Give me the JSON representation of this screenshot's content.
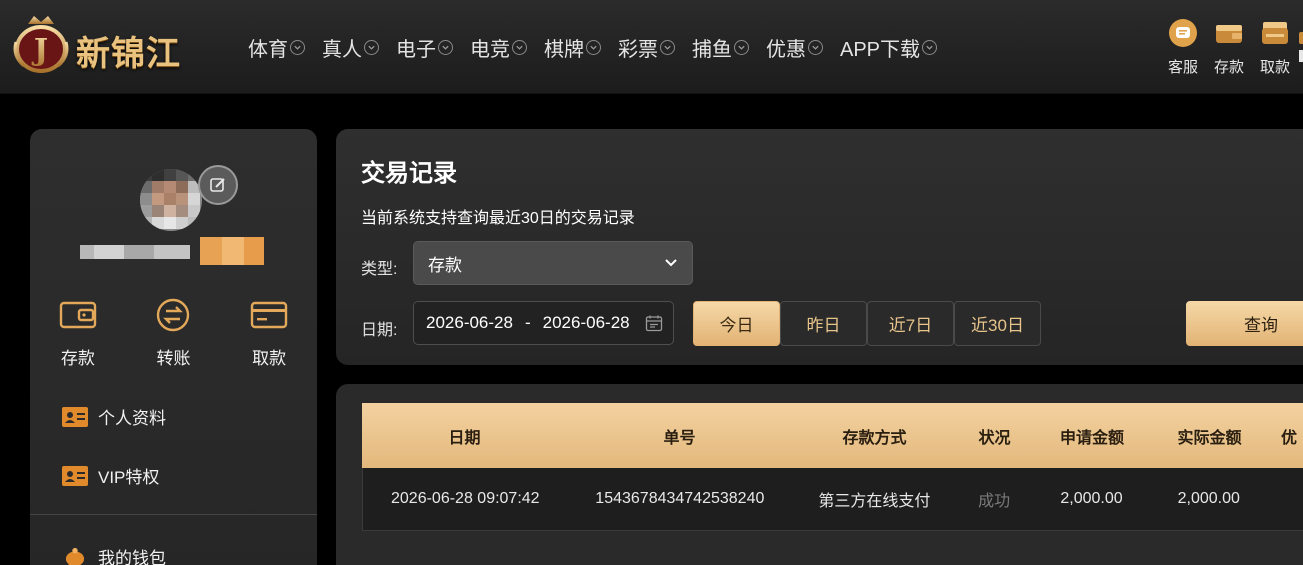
{
  "brand": {
    "name": "新锦江",
    "badge_letter": "J"
  },
  "nav": [
    {
      "label": "体育"
    },
    {
      "label": "真人"
    },
    {
      "label": "电子"
    },
    {
      "label": "电竞"
    },
    {
      "label": "棋牌"
    },
    {
      "label": "彩票"
    },
    {
      "label": "捕鱼"
    },
    {
      "label": "优惠"
    },
    {
      "label": "APP下载"
    }
  ],
  "top_actions": [
    {
      "label": "客服",
      "icon": "chat-icon"
    },
    {
      "label": "存款",
      "icon": "wallet-icon"
    },
    {
      "label": "取款",
      "icon": "wallet-icon"
    }
  ],
  "sidebar": {
    "quick": [
      {
        "label": "存款",
        "icon": "wallet-icon"
      },
      {
        "label": "转账",
        "icon": "transfer-icon"
      },
      {
        "label": "取款",
        "icon": "card-icon"
      }
    ],
    "menu": [
      {
        "label": "个人资料",
        "icon": "id-card-icon"
      },
      {
        "label": "VIP特权",
        "icon": "id-card-icon"
      },
      {
        "label": "我的钱包",
        "icon": "piggy-bank-icon"
      }
    ]
  },
  "filter": {
    "title": "交易记录",
    "note": "当前系统支持查询最近30日的交易记录",
    "type_label": "类型:",
    "type_value": "存款",
    "date_label": "日期:",
    "date_from": "2026-06-28",
    "date_sep": "-",
    "date_to": "2026-06-28",
    "quick_ranges": [
      "今日",
      "昨日",
      "近7日",
      "近30日"
    ],
    "active_range": "今日",
    "search_label": "查询"
  },
  "table": {
    "headers": [
      "日期",
      "单号",
      "存款方式",
      "状况",
      "申请金额",
      "实际金额",
      "优"
    ],
    "rows": [
      [
        "2026-06-28 09:07:42",
        "154367843474253824​0",
        "第三方在线支付",
        "成功",
        "2,000.00",
        "2,000.00",
        ""
      ]
    ]
  },
  "colors": {
    "gold": "#e3b87c",
    "gold_light": "#f6d8a8",
    "panel": "#2e2e2e",
    "status_success": "#7a7a7a"
  }
}
